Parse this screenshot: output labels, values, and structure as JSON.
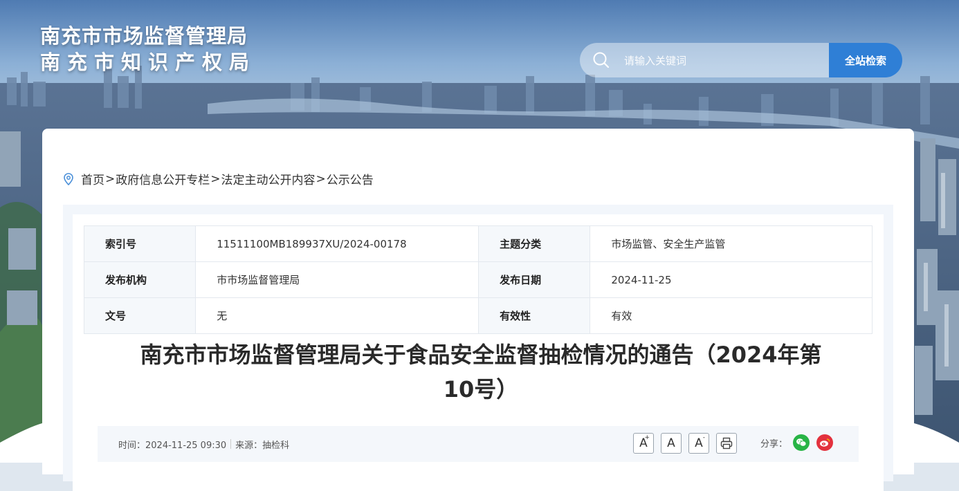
{
  "header": {
    "title_line1": "南充市市场监督管理局",
    "title_line2": "南充市知识产权局",
    "search_placeholder": "请输入关键词",
    "search_button": "全站检索"
  },
  "breadcrumb": {
    "items": [
      "首页",
      "政府信息公开专栏",
      "法定主动公开内容",
      "公示公告"
    ],
    "separator": ">"
  },
  "meta_table": {
    "rows": [
      {
        "k1": "索引号",
        "v1": "11511100MB189937XU/2024-00178",
        "k2": "主题分类",
        "v2": "市场监管、安全生产监管"
      },
      {
        "k1": "发布机构",
        "v1": "市市场监督管理局",
        "k2": "发布日期",
        "v2": "2024-11-25"
      },
      {
        "k1": "文号",
        "v1": "无",
        "k2": "有效性",
        "v2": "有效"
      }
    ]
  },
  "article": {
    "title_line1": "南充市市场监督管理局关于食品安全监督抽检情况的通告（2024年第",
    "title_line2": "10号）",
    "time": "时间：2024-11-25 09:30",
    "source": "来源：抽检科",
    "font_increase": "A",
    "font_normal": "A",
    "font_decrease": "A",
    "share_label": "分享："
  },
  "colors": {
    "accent": "#2f7fd6",
    "wechat": "#28b446",
    "weibo": "#e3313d"
  },
  "icons": [
    "search-icon",
    "location-icon",
    "print-icon",
    "wechat-icon",
    "weibo-icon"
  ]
}
